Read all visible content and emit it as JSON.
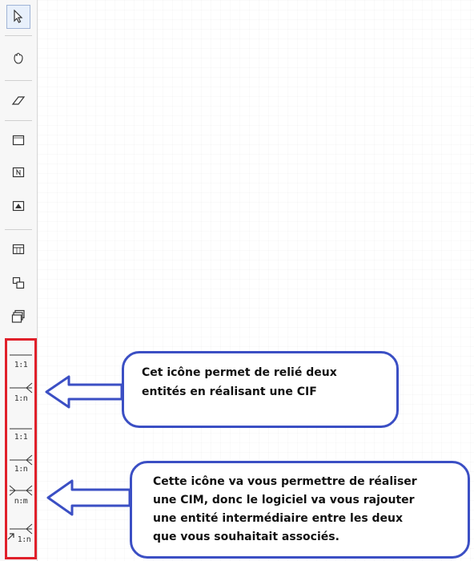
{
  "toolbar": {
    "tools": [
      {
        "name": "select-tool",
        "icon": "cursor-arrow-icon",
        "selected": true
      },
      {
        "name": "hand-tool",
        "icon": "hand-icon"
      },
      {
        "name": "eraser-tool",
        "icon": "eraser-icon"
      },
      {
        "name": "entity-tool",
        "icon": "entity-icon"
      },
      {
        "name": "entity-tool-2",
        "icon": "entity-n-icon"
      },
      {
        "name": "entity-tool-3",
        "icon": "entity-filled-icon"
      },
      {
        "name": "table-tool",
        "icon": "table-icon"
      },
      {
        "name": "copy-tool",
        "icon": "overlap-icon"
      },
      {
        "name": "stack-tool",
        "icon": "stack-icon"
      }
    ],
    "relations": [
      {
        "label": "1:1"
      },
      {
        "label": "1:n"
      },
      {
        "label": "1:1"
      },
      {
        "label": "1:n"
      },
      {
        "label": "n:m"
      },
      {
        "label": "1:n"
      }
    ]
  },
  "callouts": {
    "first": {
      "line1": "Cet icône permet de relié deux",
      "line2": "entités en réalisant une CIF"
    },
    "second": {
      "line1": "Cette icône va vous permettre de réaliser",
      "line2": "une CIM, donc le logiciel va vous rajouter",
      "line3": "une entité intermédiaire entre les deux",
      "line4": "que vous souhaitait associés."
    }
  },
  "colors": {
    "highlight": "#e0202a",
    "callout_border": "#3b4fc4"
  }
}
